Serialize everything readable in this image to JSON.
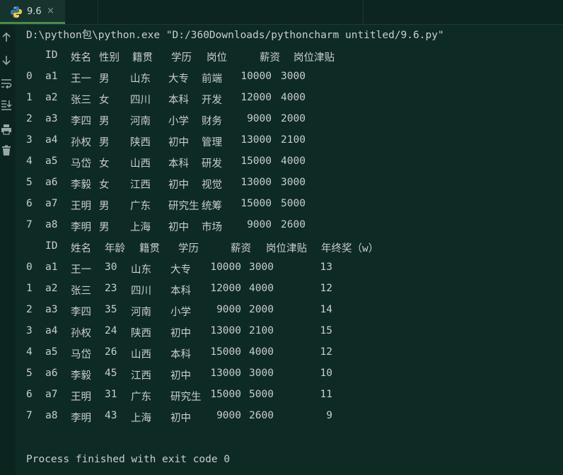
{
  "tab": {
    "title": "9.6",
    "close_glyph": "×",
    "icon": "python-icon"
  },
  "gutter": {
    "icons": [
      "arrow-up-icon",
      "arrow-down-icon",
      "soft-wrap-icon",
      "scroll-to-end-icon",
      "print-icon",
      "trash-icon"
    ]
  },
  "console": {
    "command": "D:\\python包\\python.exe \"D:/360Downloads/pythoncharm untitled/9.6.py\"",
    "table1": {
      "headers": [
        "ID",
        "姓名",
        "性别",
        "籍贯",
        "学历",
        "岗位",
        "薪资",
        "岗位津贴"
      ],
      "rows": [
        [
          "0",
          "a1",
          "王一",
          "男",
          "山东",
          "大专",
          "前端",
          "10000",
          "3000"
        ],
        [
          "1",
          "a2",
          "张三",
          "女",
          "四川",
          "本科",
          "开发",
          "12000",
          "4000"
        ],
        [
          "2",
          "a3",
          "李四",
          "男",
          "河南",
          "小学",
          "财务",
          "9000",
          "2000"
        ],
        [
          "3",
          "a4",
          "孙权",
          "男",
          "陕西",
          "初中",
          "管理",
          "13000",
          "2100"
        ],
        [
          "4",
          "a5",
          "马岱",
          "女",
          "山西",
          "本科",
          "研发",
          "15000",
          "4000"
        ],
        [
          "5",
          "a6",
          "李毅",
          "女",
          "江西",
          "初中",
          "视觉",
          "13000",
          "3000"
        ],
        [
          "6",
          "a7",
          "王明",
          "男",
          "广东",
          "研究生",
          "统筹",
          "15000",
          "5000"
        ],
        [
          "7",
          "a8",
          "李明",
          "男",
          "上海",
          "初中",
          "市场",
          "9000",
          "2600"
        ]
      ]
    },
    "table2": {
      "headers": [
        "ID",
        "姓名",
        "年龄",
        "籍贯",
        "学历",
        "薪资",
        "岗位津贴",
        "年终奖（w）"
      ],
      "rows": [
        [
          "0",
          "a1",
          "王一",
          "30",
          "山东",
          "大专",
          "10000",
          "3000",
          "13"
        ],
        [
          "1",
          "a2",
          "张三",
          "23",
          "四川",
          "本科",
          "12000",
          "4000",
          "12"
        ],
        [
          "2",
          "a3",
          "李四",
          "35",
          "河南",
          "小学",
          "9000",
          "2000",
          "14"
        ],
        [
          "3",
          "a4",
          "孙权",
          "24",
          "陕西",
          "初中",
          "13000",
          "2100",
          "15"
        ],
        [
          "4",
          "a5",
          "马岱",
          "26",
          "山西",
          "本科",
          "15000",
          "4000",
          "12"
        ],
        [
          "5",
          "a6",
          "李毅",
          "45",
          "江西",
          "初中",
          "13000",
          "3000",
          "10"
        ],
        [
          "6",
          "a7",
          "王明",
          "31",
          "广东",
          "研究生",
          "15000",
          "5000",
          "11"
        ],
        [
          "7",
          "a8",
          "李明",
          "43",
          "上海",
          "初中",
          "9000",
          "2600",
          "9"
        ]
      ]
    },
    "exit_message": "Process finished with exit code 0"
  }
}
